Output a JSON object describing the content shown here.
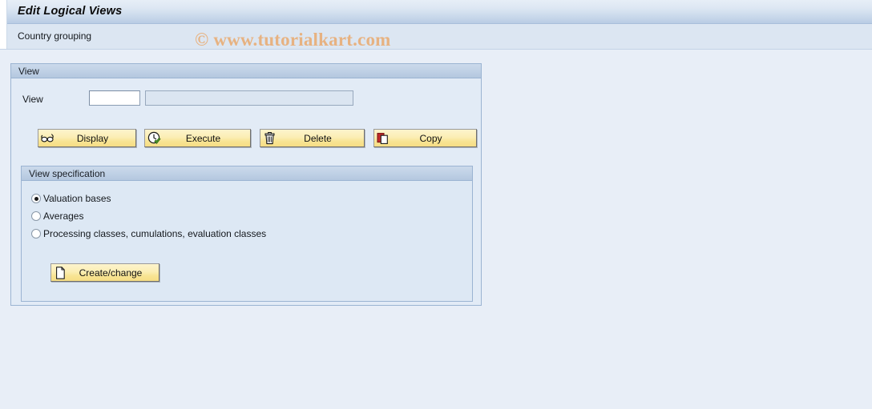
{
  "window": {
    "title": "Edit Logical Views"
  },
  "subheader": {
    "label": "Country grouping",
    "watermark": "© www.tutorialkart.com"
  },
  "view_panel": {
    "header": "View",
    "field_label": "View",
    "view_value": "",
    "view_placeholder": "",
    "description_value": "",
    "description_placeholder": "",
    "buttons": [
      {
        "label": "Display",
        "icon": "glasses-icon"
      },
      {
        "label": "Execute",
        "icon": "clock-check-icon"
      },
      {
        "label": "Delete",
        "icon": "trash-icon"
      },
      {
        "label": "Copy",
        "icon": "copy-pages-icon"
      }
    ]
  },
  "view_specification": {
    "header": "View specification",
    "options": [
      {
        "label": "Valuation bases",
        "selected": true
      },
      {
        "label": "Averages",
        "selected": false
      },
      {
        "label": "Processing classes, cumulations, evaluation classes",
        "selected": false
      }
    ],
    "create_change_button": {
      "label": "Create/change",
      "icon": "document-page-icon"
    }
  },
  "colors": {
    "page_background": "#e8eef7",
    "panel_background": "#e2ebf6",
    "panel_header": "#bfd0e5",
    "panel_border": "#9bb4d2",
    "button_face": "#f9e79a",
    "watermark": "#e8b07c",
    "title_text": "#0a0a0a"
  }
}
